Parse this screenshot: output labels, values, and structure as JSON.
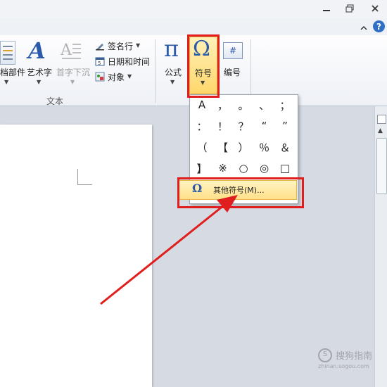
{
  "window": {
    "minimize_icon": "minimize-icon",
    "restore_icon": "restore-icon",
    "close_icon": "close-icon"
  },
  "ribbon_top": {
    "collapse_icon": "chevron-up-icon",
    "help_icon": "?"
  },
  "ribbon": {
    "text_group": {
      "label": "文本",
      "quick_parts_label": "档部件",
      "wordart_label": "艺术字",
      "dropcap_label": "首字下沉",
      "signature_line_label": "签名行",
      "datetime_label": "日期和时间",
      "object_label": "对象"
    },
    "symbols_group": {
      "equation_label": "公式",
      "symbol_label": "符号",
      "number_label": "编号",
      "equation_glyph": "π",
      "symbol_glyph": "Ω",
      "number_glyph": "#"
    }
  },
  "symbol_menu": {
    "symbols": [
      "A",
      "，",
      "。",
      "、",
      "；",
      "：",
      "！",
      "？",
      "“",
      "”",
      "（",
      "【",
      "）",
      "％",
      "＆",
      "】",
      "※",
      "○",
      "◎",
      "□"
    ],
    "more_symbols_icon": "Ω",
    "more_symbols_label": "其他符号(M)..."
  },
  "watermark": {
    "brand": "搜狗指南",
    "url": "zhinan.sogou.com"
  },
  "colors": {
    "annotation_red": "#e01e1e",
    "highlight": "#ffe08a",
    "accent_blue": "#2a5aa8"
  }
}
